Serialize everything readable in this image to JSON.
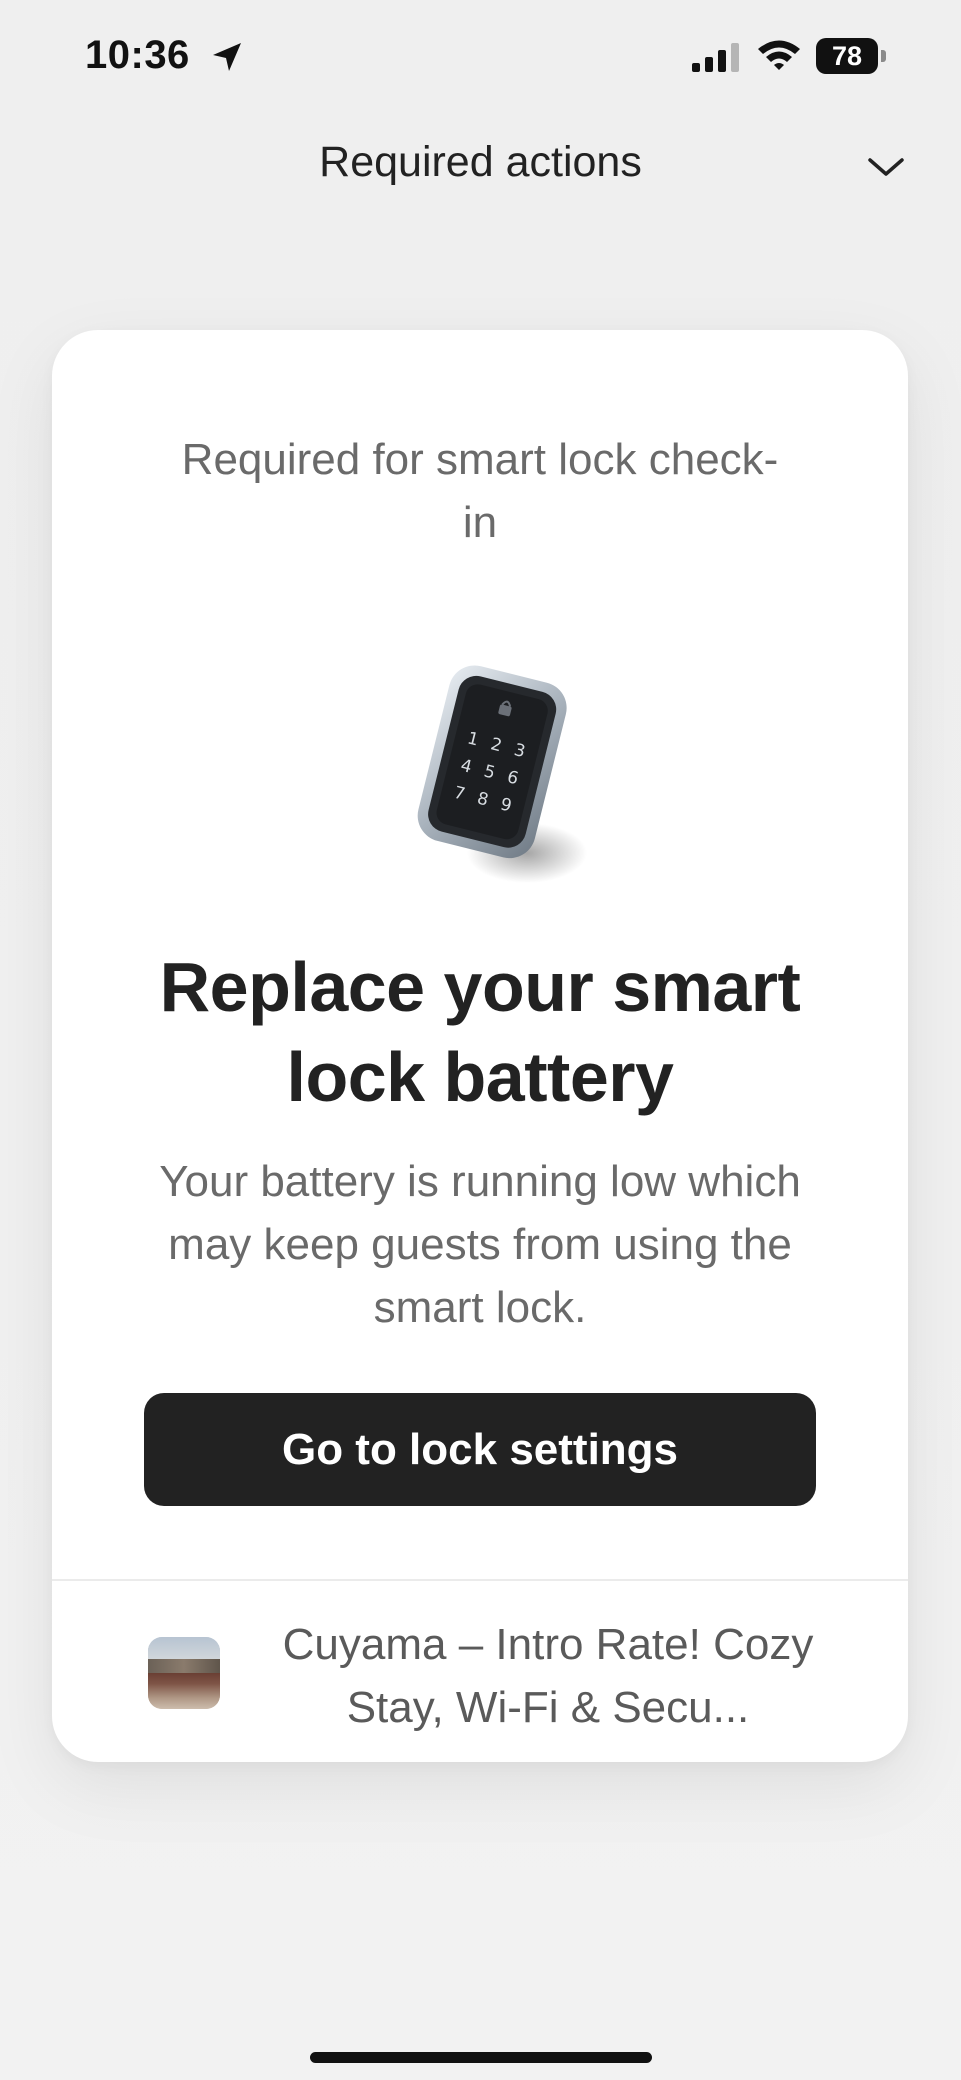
{
  "status_bar": {
    "time": "10:36",
    "battery_level": "78",
    "location_icon": "location-arrow-icon",
    "signal_icon": "cellular-signal-icon",
    "wifi_icon": "wifi-icon",
    "battery_icon": "battery-icon"
  },
  "header": {
    "title": "Required actions",
    "collapse_icon": "chevron-down-icon"
  },
  "card": {
    "subtitle": "Required for smart lock check-in",
    "image": "smart-lock-keypad-image",
    "keypad_digits": [
      "1",
      "2",
      "3",
      "4",
      "5",
      "6",
      "7",
      "8",
      "9"
    ],
    "heading": "Replace your smart lock battery",
    "body": "Your battery is running low which may keep guests from using the smart lock.",
    "button_label": "Go to lock settings",
    "listing": {
      "title": "Cuyama – Intro Rate! Cozy Stay, Wi-Fi & Secu..."
    }
  },
  "colors": {
    "background": "#efefef",
    "card": "#ffffff",
    "button": "#222222",
    "button_text": "#ffffff",
    "secondary_text": "#6a6a6a"
  }
}
